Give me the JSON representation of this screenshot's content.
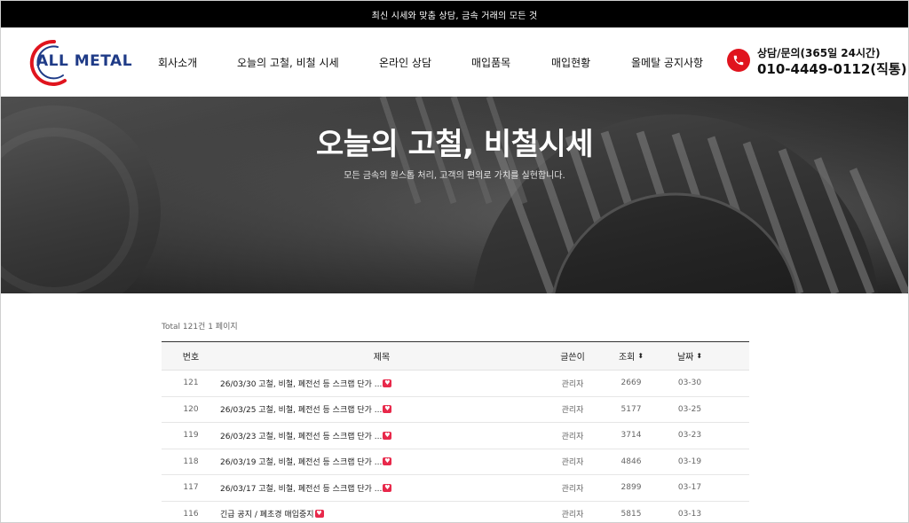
{
  "topbar": {
    "text": "최신 시세와 맞춤 상담, 금속 거래의 모든 것"
  },
  "header": {
    "logo_text": "ALL METAL",
    "nav": [
      {
        "label": "회사소개"
      },
      {
        "label": "오늘의 고철, 비철 시세"
      },
      {
        "label": "온라인 상담"
      },
      {
        "label": "매입품목"
      },
      {
        "label": "매입현황"
      },
      {
        "label": "올메탈 공지사항"
      }
    ],
    "contact": {
      "label": "상담/문의(365일 24시간)",
      "number": "010-4449-0112(직통)"
    }
  },
  "hero": {
    "title": "오늘의 고철, 비철시세",
    "subtitle": "모든 금속의 원스톱 처리, 고객의 편의로 가치를 실현합니다."
  },
  "board": {
    "total": "Total 121건 1 페이지",
    "headers": {
      "no": "번호",
      "title": "제목",
      "author": "글쓴이",
      "views": "조회",
      "date": "날짜"
    },
    "rows": [
      {
        "no": "121",
        "title": "26/03/30 고철, 비철, 폐전선 등 스크랩 단가 ...",
        "author": "관리자",
        "views": "2669",
        "date": "03-30"
      },
      {
        "no": "120",
        "title": "26/03/25 고철, 비철, 폐전선 등 스크랩 단가 ...",
        "author": "관리자",
        "views": "5177",
        "date": "03-25"
      },
      {
        "no": "119",
        "title": "26/03/23 고철, 비철, 폐전선 등 스크랩 단가 ...",
        "author": "관리자",
        "views": "3714",
        "date": "03-23"
      },
      {
        "no": "118",
        "title": "26/03/19 고철, 비철, 폐전선 등 스크랩 단가 ...",
        "author": "관리자",
        "views": "4846",
        "date": "03-19"
      },
      {
        "no": "117",
        "title": "26/03/17 고철, 비철, 폐전선 등 스크랩 단가 ...",
        "author": "관리자",
        "views": "2899",
        "date": "03-17"
      },
      {
        "no": "116",
        "title": "긴급 공지 / 폐초경 매입중지",
        "author": "관리자",
        "views": "5815",
        "date": "03-13"
      }
    ]
  },
  "colors": {
    "accent_red": "#e0141e",
    "logo_blue": "#1f3b87",
    "heart": "#e8294b"
  }
}
